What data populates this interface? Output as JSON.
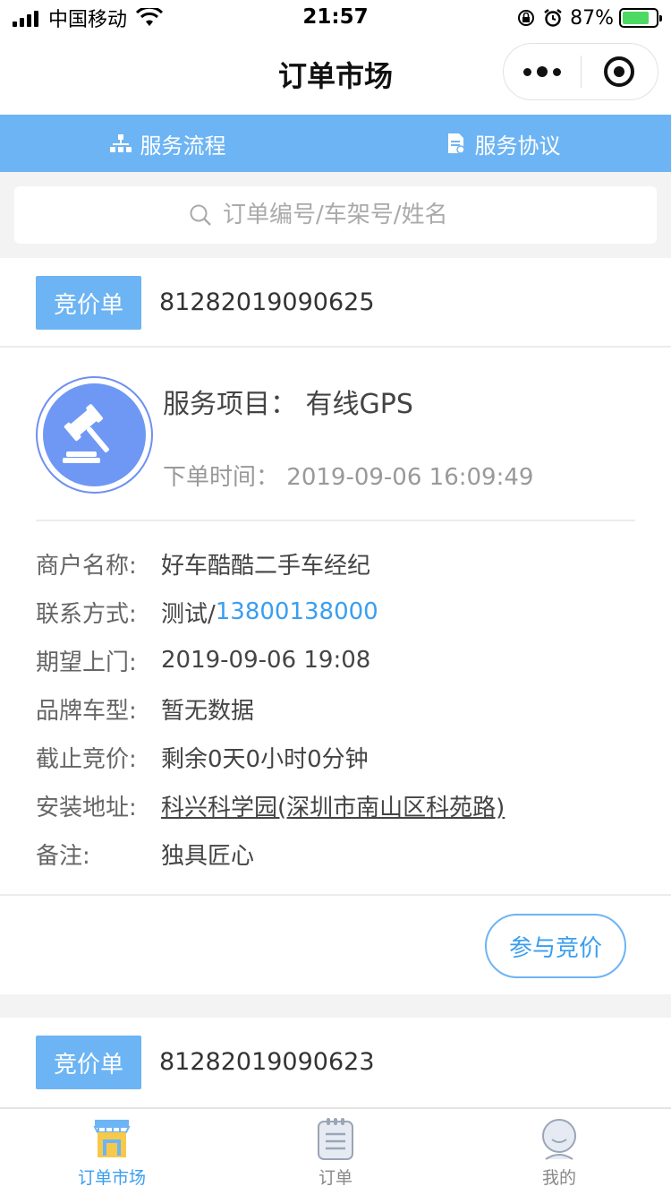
{
  "status_bar": {
    "carrier": "中国移动",
    "time": "21:57",
    "battery": "87%"
  },
  "nav": {
    "title": "订单市场"
  },
  "top_tabs": [
    {
      "label": "服务流程",
      "icon": "flow-chart-icon"
    },
    {
      "label": "服务协议",
      "icon": "document-icon"
    }
  ],
  "search": {
    "placeholder": "订单编号/车架号/姓名"
  },
  "orders": [
    {
      "badge": "竞价单",
      "order_no": "81282019090625",
      "service_label": "服务项目：",
      "service_value": "有线GPS",
      "time_label": "下单时间：",
      "time_value": "2019-09-06 16:09:49",
      "details": [
        {
          "label": "商户名称:",
          "value": "好车酷酷二手车经纪"
        },
        {
          "label": "联系方式:",
          "value_prefix": "测试/",
          "value_phone": "13800138000"
        },
        {
          "label": "期望上门:",
          "value": "2019-09-06 19:08"
        },
        {
          "label": "品牌车型:",
          "value": "暂无数据"
        },
        {
          "label": "截止竞价:",
          "value": "剩余0天0小时0分钟"
        },
        {
          "label": "安装地址:",
          "value": "科兴科学园(深圳市南山区科苑路)"
        },
        {
          "label": "备注:",
          "value": "独具匠心"
        }
      ],
      "action": "参与竞价"
    },
    {
      "badge": "竞价单",
      "order_no": "81282019090623"
    }
  ],
  "tab_bar": [
    {
      "label": "订单市场",
      "icon": "market-icon",
      "active": true
    },
    {
      "label": "订单",
      "icon": "clipboard-icon",
      "active": false
    },
    {
      "label": "我的",
      "icon": "user-icon",
      "active": false
    }
  ],
  "colors": {
    "accent": "#6db4f4",
    "link": "#3a9ef0",
    "avatar": "#6f98f5"
  }
}
